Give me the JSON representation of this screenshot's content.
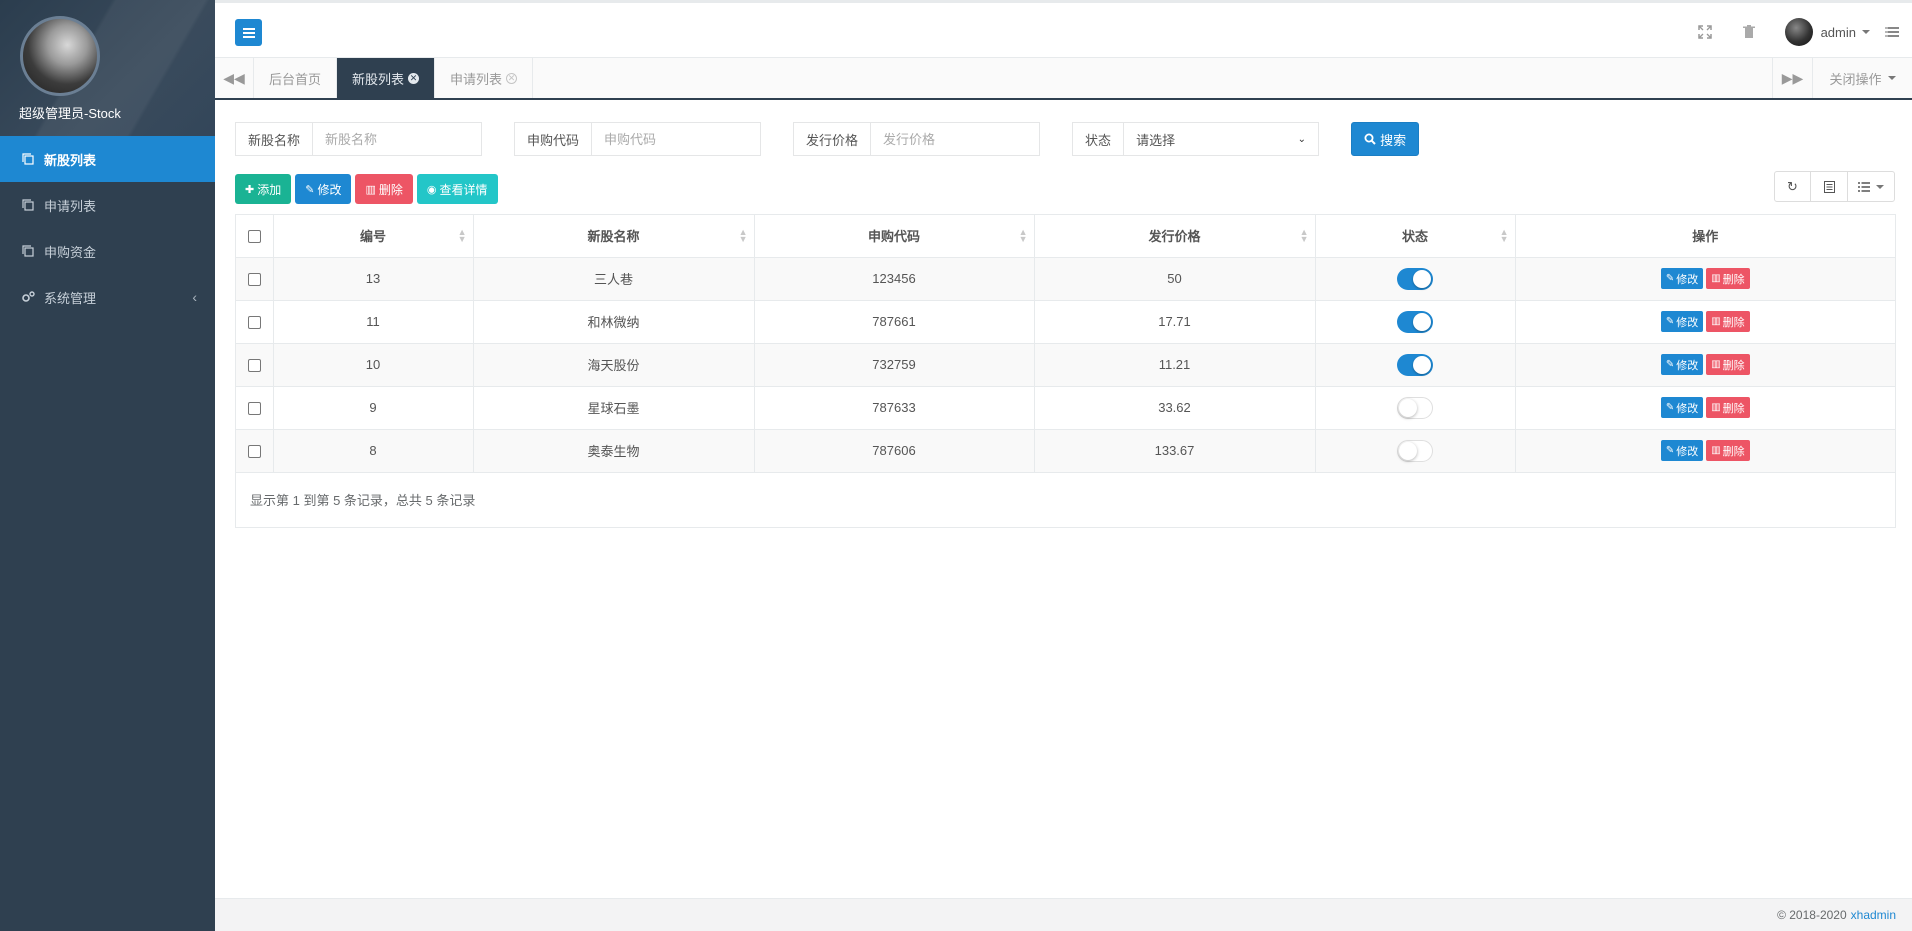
{
  "sidebar": {
    "profile_name": "超级管理员-Stock",
    "items": [
      {
        "label": "新股列表",
        "active": true
      },
      {
        "label": "申请列表",
        "active": false
      },
      {
        "label": "申购资金",
        "active": false
      },
      {
        "label": "系统管理",
        "active": false,
        "has_submenu": true
      }
    ]
  },
  "topbar": {
    "user_name": "admin",
    "icons": [
      "fullscreen-icon",
      "trash-icon",
      "avatar",
      "settings-list-icon"
    ]
  },
  "tabs": {
    "items": [
      {
        "label": "后台首页",
        "active": false,
        "closable": false
      },
      {
        "label": "新股列表",
        "active": true,
        "closable": true
      },
      {
        "label": "申请列表",
        "active": false,
        "closable": true
      }
    ],
    "close_ops_label": "关闭操作"
  },
  "search": {
    "fields": [
      {
        "label": "新股名称",
        "placeholder": "新股名称"
      },
      {
        "label": "申购代码",
        "placeholder": "申购代码"
      },
      {
        "label": "发行价格",
        "placeholder": "发行价格"
      }
    ],
    "status_label": "状态",
    "status_selected": "请选择",
    "search_button": "搜索"
  },
  "toolbar": {
    "add": "添加",
    "edit": "修改",
    "delete": "删除",
    "detail": "查看详情"
  },
  "table": {
    "headers": [
      "编号",
      "新股名称",
      "申购代码",
      "发行价格",
      "状态",
      "操作"
    ],
    "rows": [
      {
        "id": "13",
        "name": "三人巷",
        "code": "123456",
        "price": "50",
        "status": true
      },
      {
        "id": "11",
        "name": "和林微纳",
        "code": "787661",
        "price": "17.71",
        "status": true
      },
      {
        "id": "10",
        "name": "海天股份",
        "code": "732759",
        "price": "11.21",
        "status": true
      },
      {
        "id": "9",
        "name": "星球石墨",
        "code": "787633",
        "price": "33.62",
        "status": false
      },
      {
        "id": "8",
        "name": "奥泰生物",
        "code": "787606",
        "price": "133.67",
        "status": false
      }
    ],
    "row_edit": "修改",
    "row_delete": "删除",
    "pagination_info": "显示第 1 到第 5 条记录，总共 5 条记录"
  },
  "footer": {
    "copyright": "© 2018-2020",
    "brand": "xhadmin"
  },
  "colors": {
    "sidebar_bg": "#2f4050",
    "primary": "#1e88d2",
    "success": "#1ab394",
    "danger": "#ed5565",
    "info": "#23c6c8"
  }
}
